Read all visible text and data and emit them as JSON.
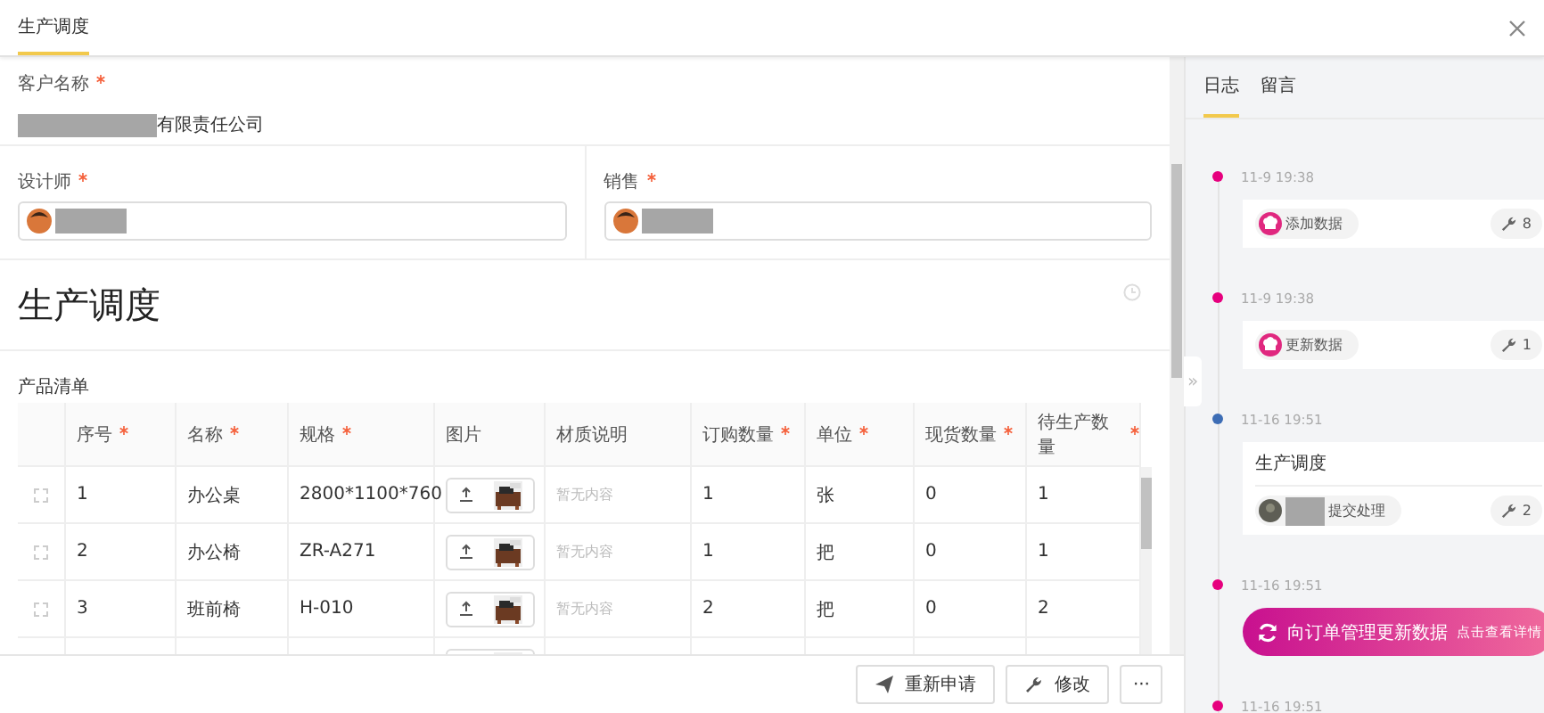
{
  "tabs": [
    {
      "label": "生产调度",
      "selected": true
    }
  ],
  "customer": {
    "label": "客户名称",
    "required": true,
    "value_suffix": "有限责任公司"
  },
  "people": [
    {
      "label": "设计师",
      "required": true
    },
    {
      "label": "销售",
      "required": true
    }
  ],
  "section_title": "生产调度",
  "product_list": {
    "title": "产品清单",
    "columns": [
      {
        "label": "序号",
        "required": true
      },
      {
        "label": "名称",
        "required": true
      },
      {
        "label": "规格",
        "required": true
      },
      {
        "label": "图片",
        "required": false
      },
      {
        "label": "材质说明",
        "required": false
      },
      {
        "label": "订购数量",
        "required": true
      },
      {
        "label": "单位",
        "required": true
      },
      {
        "label": "现货数量",
        "required": true
      },
      {
        "label": "待生产数量",
        "required": true
      }
    ],
    "rows": [
      {
        "cells": [
          "1",
          "办公桌",
          "2800*1100*760",
          "",
          "暂无内容",
          "1",
          "张",
          "0",
          "1"
        ]
      },
      {
        "cells": [
          "2",
          "办公椅",
          "ZR-A271",
          "",
          "暂无内容",
          "1",
          "把",
          "0",
          "1"
        ]
      },
      {
        "cells": [
          "3",
          "班前椅",
          "H-010",
          "",
          "暂无内容",
          "2",
          "把",
          "0",
          "2"
        ]
      },
      {
        "cells": [
          "",
          "",
          "",
          "",
          "",
          "",
          "",
          "",
          ""
        ]
      }
    ]
  },
  "footer_buttons": [
    {
      "kind": "send",
      "label": "重新申请"
    },
    {
      "kind": "wrench",
      "label": "修改"
    },
    {
      "kind": "more",
      "label": "···"
    }
  ],
  "collapse_handle": "»",
  "side_tabs": [
    {
      "label": "日志",
      "selected": true
    },
    {
      "label": "留言",
      "selected": false
    }
  ],
  "timeline": [
    {
      "kind": "action",
      "time": "11-9 19:38",
      "color": "#e6007e",
      "action": "添加数据",
      "count": "8"
    },
    {
      "kind": "action",
      "time": "11-9 19:38",
      "color": "#e6007e",
      "action": "更新数据",
      "count": "1"
    },
    {
      "kind": "task",
      "time": "11-16 19:51",
      "color": "#3d6db5",
      "title": "生产调度",
      "action": "提交处理",
      "count": "2"
    },
    {
      "kind": "banner",
      "time": "11-16 19:51",
      "color": "#e6007e",
      "title": "向订单管理更新数据",
      "link": "点击查看详情"
    },
    {
      "kind": "time_only",
      "time": "11-16 19:51",
      "color": "#e6007e"
    }
  ]
}
